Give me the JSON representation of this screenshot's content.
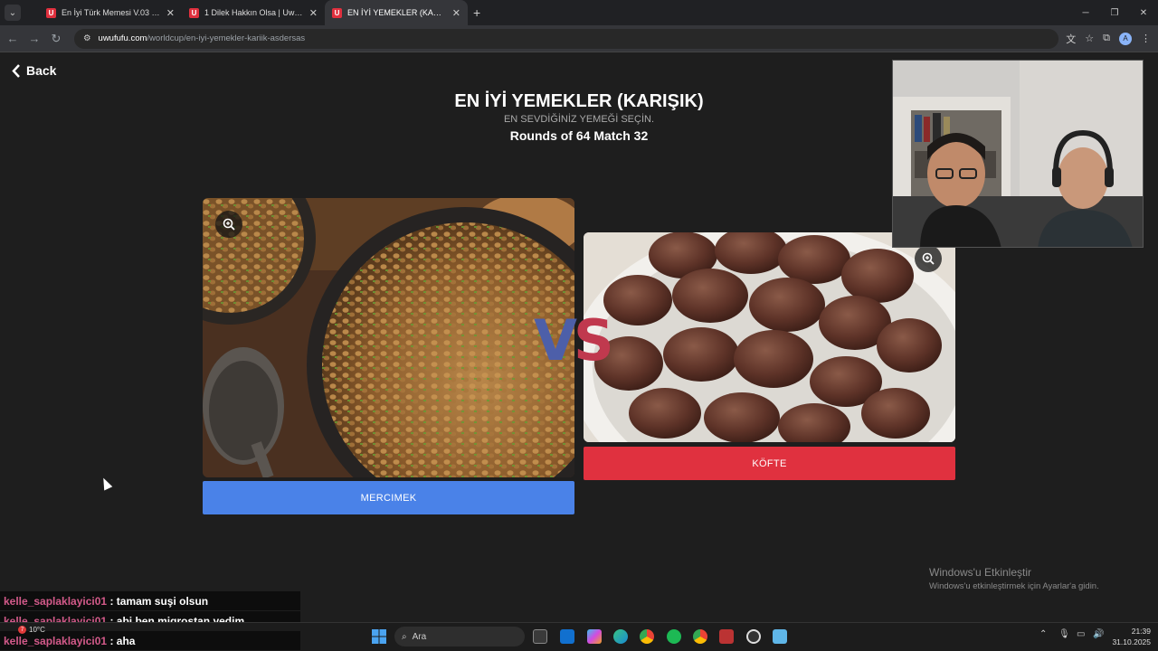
{
  "browser": {
    "tabs": [
      {
        "title": "En İyi Türk Memesi V.03 | UwUFUFU",
        "active": false
      },
      {
        "title": "1 Dilek Hakkın Olsa | UwUFUFU",
        "active": false
      },
      {
        "title": "EN İYİ YEMEKLER (KARIŞIK) | UwUFUFU",
        "active": true
      }
    ],
    "url_host": "uwufufu.com",
    "url_path": "/worldcup/en-iyi-yemekler-kariik-asdersas",
    "profile_initial": "A"
  },
  "page": {
    "back_label": "Back",
    "title": "EN İYİ YEMEKLER (KARIŞIK)",
    "subtitle": "EN SEVDİĞİNİZ YEMEĞİ SEÇİN.",
    "round_info": "Rounds of 64 Match 32",
    "vs_v": "V",
    "vs_s": "S",
    "left_choice": {
      "label": "MERCIMEK",
      "button_color": "#4a82e8"
    },
    "right_choice": {
      "label": "KÖFTE",
      "button_color": "#e0313f"
    }
  },
  "watermark": {
    "line1": "Windows'u Etkinleştir",
    "line2": "Windows'u etkinleştirmek için Ayarlar'a gidin."
  },
  "chat": [
    {
      "user": "kelle_saplaklayici01",
      "message": ": tamam suşi olsun"
    },
    {
      "user": "kelle_saplaklayici01",
      "message": ": abi ben migrostan yedim"
    },
    {
      "user": "kelle_saplaklayici01",
      "message": ": aha"
    }
  ],
  "taskbar": {
    "search_placeholder": "Ara",
    "weather_temp": "10°C",
    "weather_badge": "7",
    "time": "21:39",
    "date": "31.10.2025"
  }
}
